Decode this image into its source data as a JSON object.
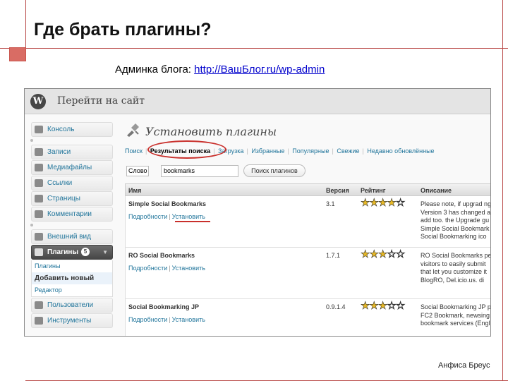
{
  "slide": {
    "title": "Где брать плагины?",
    "subtitle_label": "Админка блога:",
    "subtitle_link": "http://ВашБлог.ru/wp-admin",
    "author": "Анфиса Бреус"
  },
  "wp": {
    "logo": "W",
    "site_link": "Перейти на сайт",
    "menu": [
      {
        "label": "Консоль",
        "icon": "dashboard-icon"
      },
      {
        "label": "Записи",
        "icon": "pin-icon"
      },
      {
        "label": "Медиафайлы",
        "icon": "media-icon"
      },
      {
        "label": "Ссылки",
        "icon": "link-icon"
      },
      {
        "label": "Страницы",
        "icon": "page-icon"
      },
      {
        "label": "Комментарии",
        "icon": "comments-icon"
      },
      {
        "label": "Внешний вид",
        "icon": "appearance-icon"
      },
      {
        "label": "Плагины",
        "icon": "plugins-icon",
        "badge": "5"
      },
      {
        "label": "Пользователи",
        "icon": "users-icon"
      },
      {
        "label": "Инструменты",
        "icon": "tools-icon"
      }
    ],
    "submenu": [
      "Плагины",
      "Добавить новый",
      "Редактор"
    ],
    "page_title": "Установить плагины",
    "tabs": [
      "Поиск",
      "Результаты поиска",
      "Загрузка",
      "Избранные",
      "Популярные",
      "Свежие",
      "Недавно обновлённые"
    ],
    "search": {
      "select_value": "Слово",
      "input_value": "bookmarks",
      "button": "Поиск плагинов"
    },
    "columns": [
      "Имя",
      "Версия",
      "Рейтинг",
      "Описание"
    ],
    "rows": [
      {
        "name": "Simple Social Bookmarks",
        "details": "Подробности",
        "install": "Установить",
        "version": "3.1",
        "rating": 3.5,
        "desc": [
          "Please note, if upgrad ng",
          "Version 3 has changed a",
          "add too. the Upgrade gu",
          "Simple Social Bookmark",
          "Social Bookmarking ico"
        ]
      },
      {
        "name": "RO Social Bookmarks",
        "details": "Подробности",
        "install": "Установить",
        "version": "1.7.1",
        "rating": 3,
        "desc": [
          "RO Social Bookmarks pe",
          "visitors to easily submit",
          "that let you customize it",
          "BlogRO, Del.icio.us. di",
          ""
        ]
      },
      {
        "name": "Social Bookmarking JP",
        "details": "Подробности",
        "install": "Установить",
        "version": "0.9.1.4",
        "rating": 3,
        "desc": [
          "Social Bookmarking JP p",
          "FC2 Bookmark, newsing",
          "bookmark services (Engl",
          "",
          ""
        ]
      }
    ]
  }
}
